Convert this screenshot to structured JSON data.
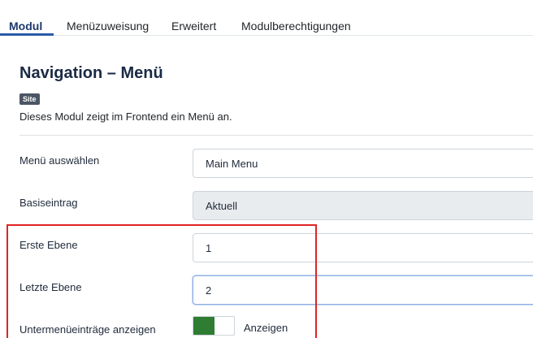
{
  "tabs": [
    {
      "label": "Modul"
    },
    {
      "label": "Menüzuweisung"
    },
    {
      "label": "Erweitert"
    },
    {
      "label": "Modulberechtigungen"
    }
  ],
  "module": {
    "title": "Navigation – Menü",
    "badge": "Site",
    "description": "Dieses Modul zeigt im Frontend ein Menü an."
  },
  "fields": {
    "menu": {
      "label": "Menü auswählen",
      "value": "Main Menu"
    },
    "base": {
      "label": "Basiseintrag",
      "value": "Aktuell"
    },
    "start_level": {
      "label": "Erste Ebene",
      "value": "1"
    },
    "end_level": {
      "label": "Letzte Ebene",
      "value": "2"
    },
    "show_submenu": {
      "label": "Untermenüeinträge anzeigen",
      "state_label": "Anzeigen"
    }
  },
  "colors": {
    "accent": "#2a5ba8",
    "toggle_on": "#2f7d32",
    "highlight": "#e02424"
  }
}
